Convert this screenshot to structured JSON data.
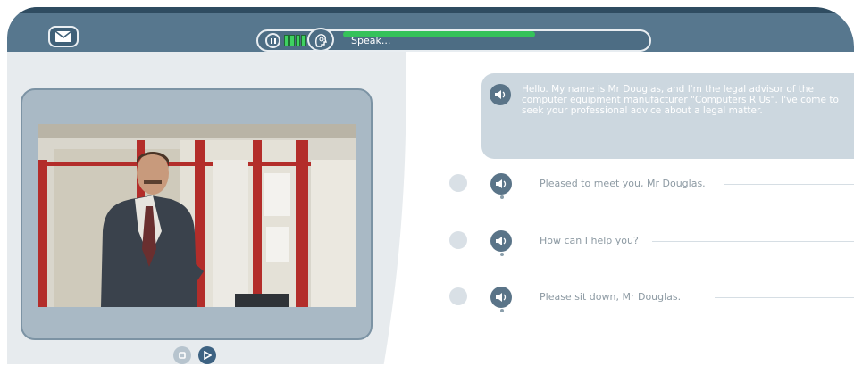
{
  "topbar": {
    "mail_icon": "mail-icon",
    "speak_label": "Speak...",
    "progress_fraction": 0.57
  },
  "icons": {
    "pause": "pause-icon",
    "level": "audio-level-icon",
    "head": "speaking-head-icon",
    "speaker": "speaker-icon",
    "stop": "stop-icon",
    "play": "play-icon"
  },
  "dialogue": {
    "message": "Hello. My name is Mr Douglas, and I'm the legal advisor of the computer equipment manufacturer \"Computers R Us\". I've come to seek your professional advice about a legal matter.",
    "options": [
      {
        "label": "Pleased to meet you, Mr Douglas."
      },
      {
        "label": "How can I help you?"
      },
      {
        "label": "Please sit down, Mr Douglas."
      }
    ]
  },
  "colors": {
    "topbar": "#57778e",
    "accent_green": "#35c25a",
    "bubble": "#ccd7df",
    "video_frame": "#a9b9c5"
  }
}
